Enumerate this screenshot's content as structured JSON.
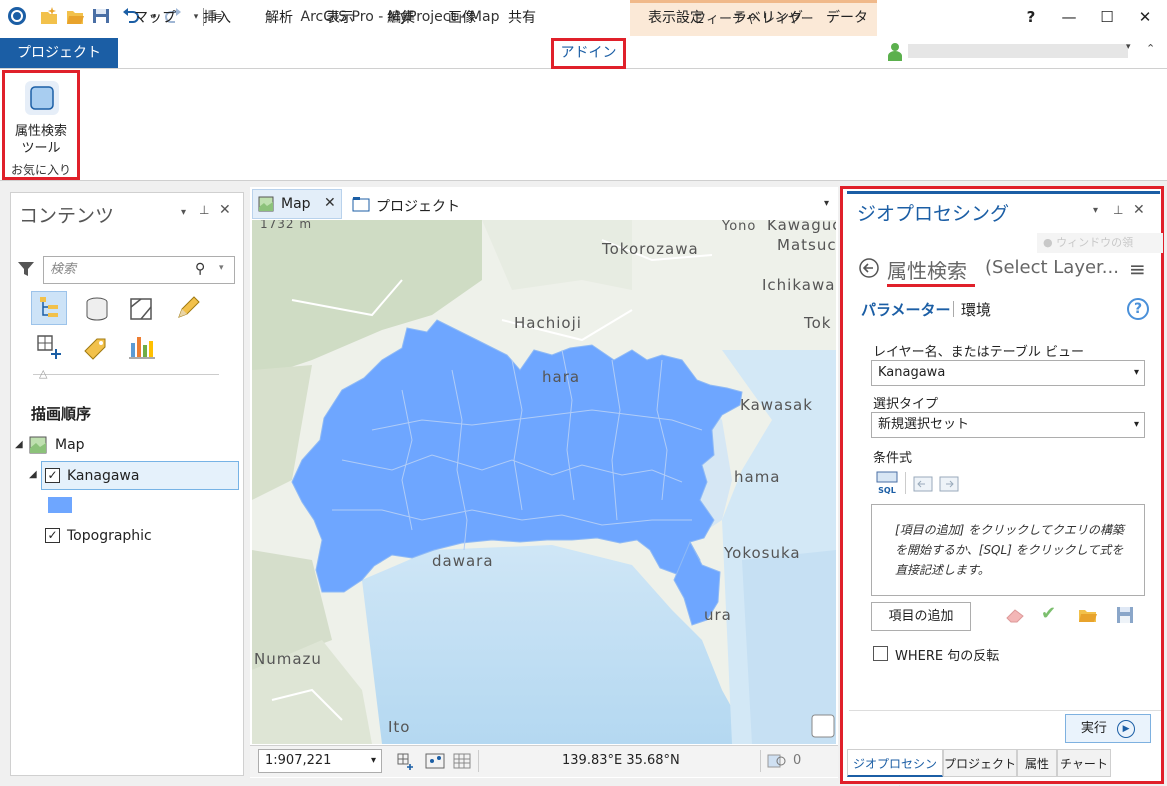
{
  "app": {
    "title": "ArcGIS Pro - MyProject - Map",
    "contextual_tab": "フィーチャ レイヤー",
    "help": "?",
    "min": "—",
    "max": "☐",
    "close": "✕"
  },
  "tabs": {
    "project": "プロジェクト",
    "items": [
      "マップ",
      "挿入",
      "解析",
      "表示",
      "編集",
      "画像",
      "共有",
      "アドイン",
      "表示設定",
      "ラベリング",
      "データ"
    ]
  },
  "ribbon": {
    "tool_label_1": "属性検索",
    "tool_label_2": "ツール",
    "group_label": "お気に入り"
  },
  "contents": {
    "title": "コンテンツ",
    "search_placeholder": "検索",
    "drawing_order": "描画順序",
    "map": "Map",
    "layer1": "Kanagawa",
    "layer2": "Topographic"
  },
  "map": {
    "tab_map": "Map",
    "tab_project": "プロジェクト",
    "scale": "1:907,221",
    "coords": "139.83°E 35.68°N",
    "selected_count": "0",
    "labels": {
      "scale_text": "1732 m",
      "tokorozawa": "Tokorozawa",
      "kawaguchi": "Kawaguc",
      "matsudo": "Matsuc",
      "yono": "Yono",
      "hachioji": "Hachioji",
      "ichikawa": "Ichikawa",
      "tok": "Tok",
      "hara": "hara",
      "kawasaki": "Kawasak",
      "hama": "hama",
      "yokosuka": "Yokosuka",
      "dawara": "dawara",
      "numazu": "Numazu",
      "ura": "ura",
      "ito": "Ito"
    }
  },
  "geo": {
    "title": "ジオプロセシング",
    "tool_title": "属性検索",
    "tool_subtitle": "(Select Layer...",
    "tab_params": "パラメーター",
    "tab_env": "環境",
    "watermark": "ウィンドウの領",
    "layer_label": "レイヤー名、またはテーブル ビュー",
    "layer_value": "Kanagawa",
    "type_label": "選択タイプ",
    "type_value": "新規選択セット",
    "expr_label": "条件式",
    "sql_label": "SQL",
    "expr_hint": "[項目の追加] をクリックしてクエリの構築を開始するか、[SQL] をクリックして式を直接記述します。",
    "add_item": "項目の追加",
    "invert": "WHERE 句の反転",
    "run": "実行",
    "bottom_tabs": [
      "ジオプロセシング",
      "プロジェクト",
      "属性",
      "チャート"
    ]
  },
  "colors": {
    "accent": "#1b5ea5",
    "highlight": "#e0202a",
    "layer_fill": "#6ea6ff"
  }
}
